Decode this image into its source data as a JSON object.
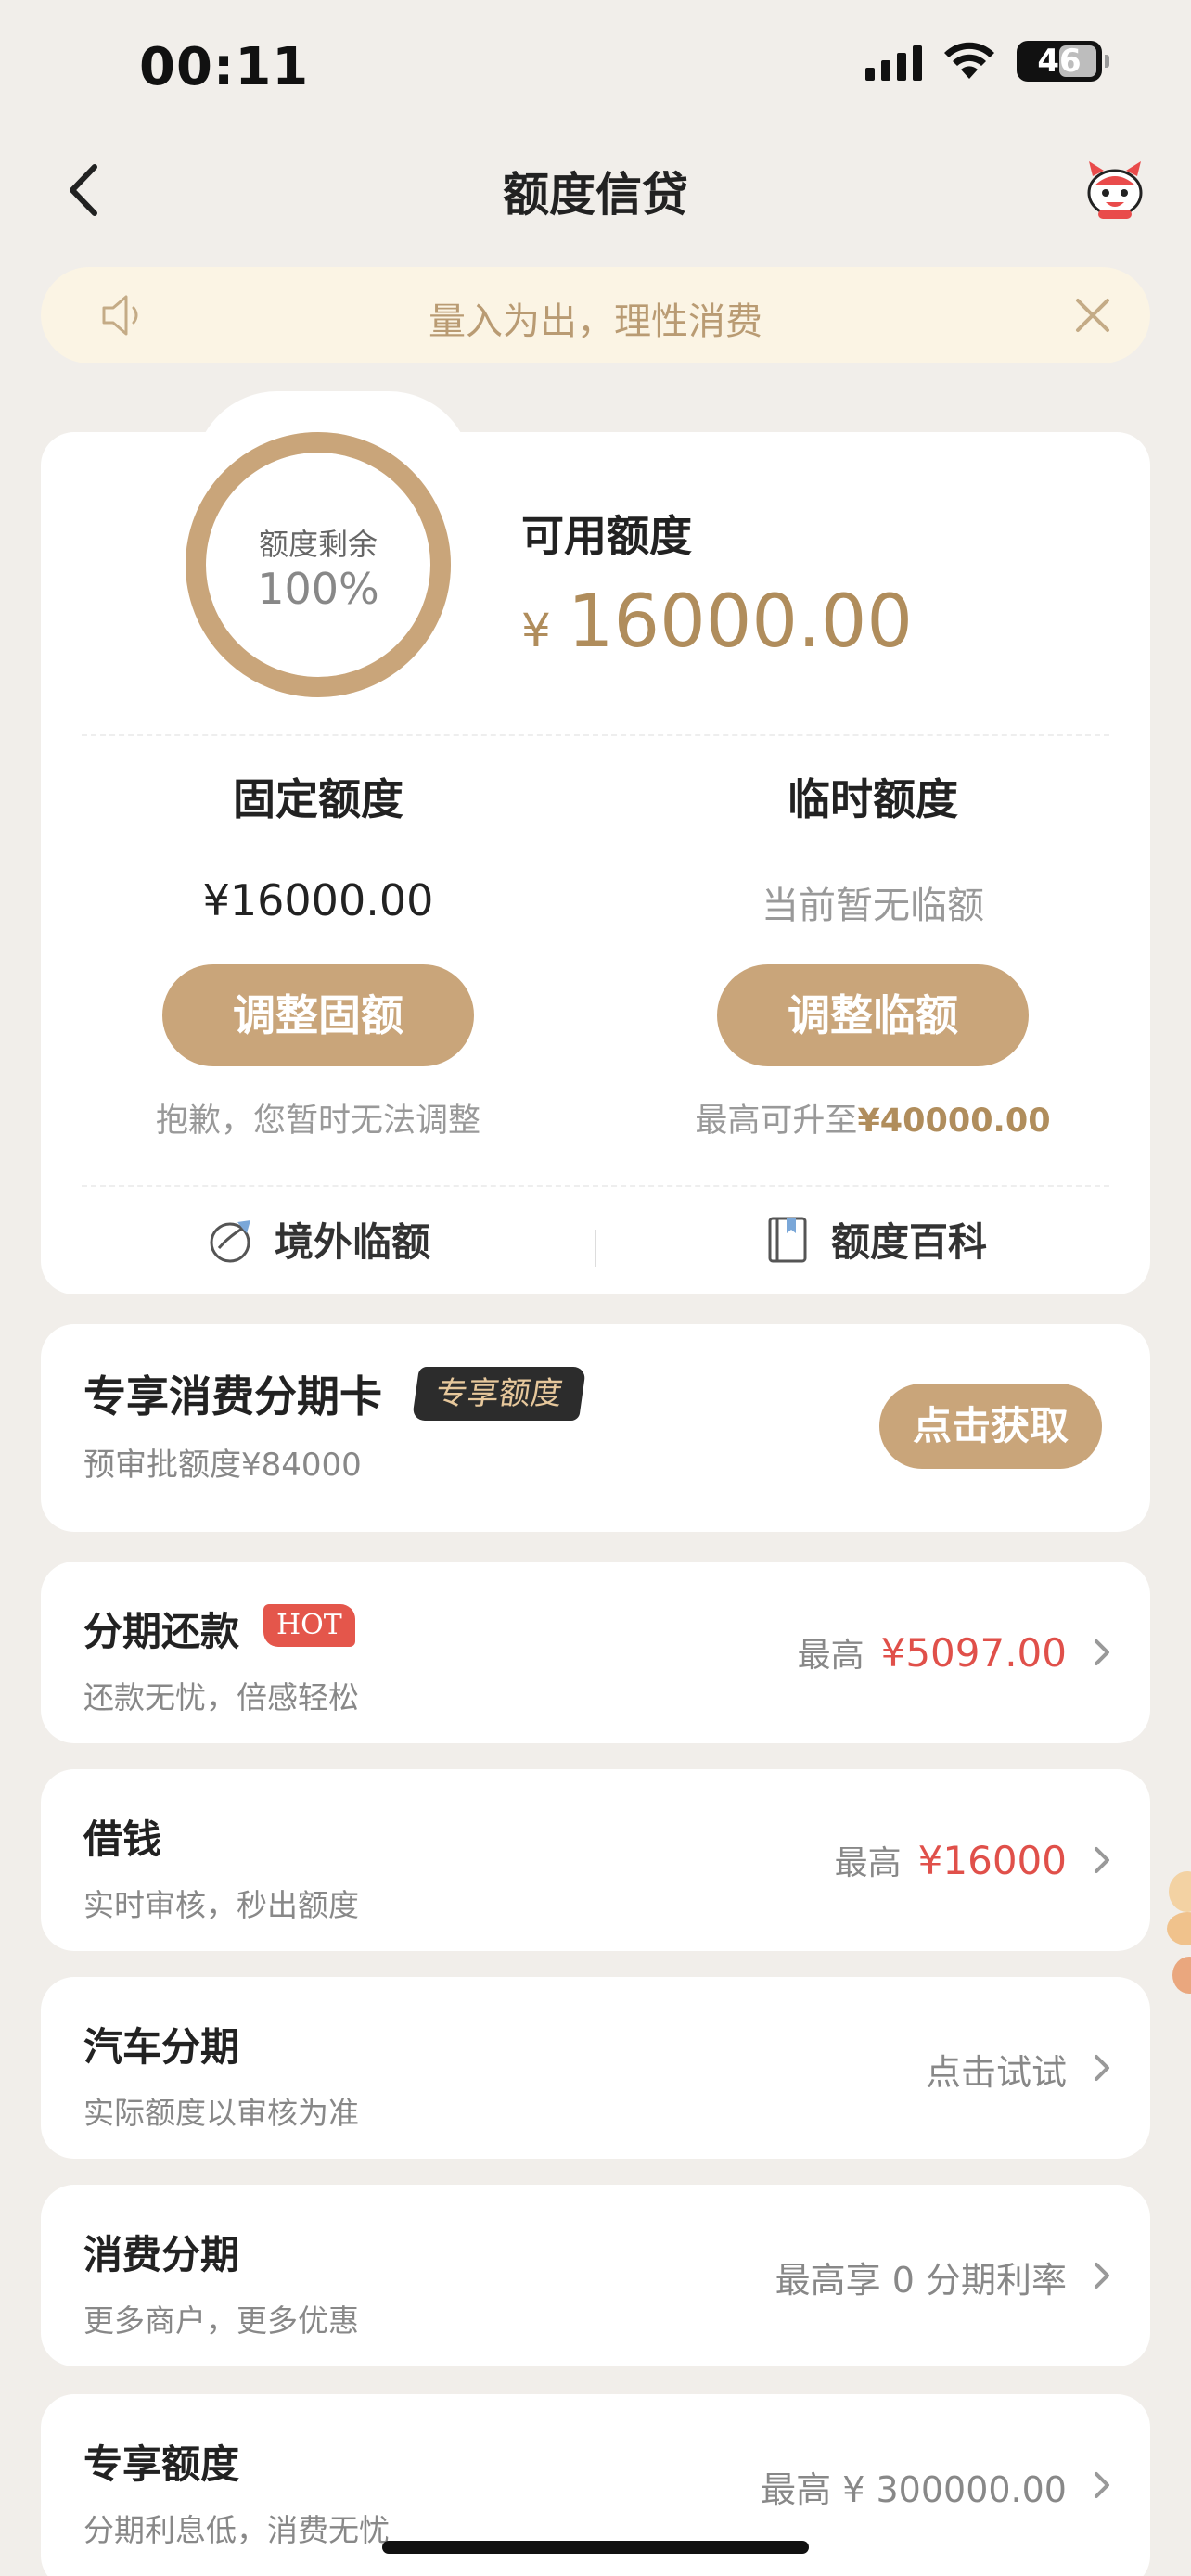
{
  "status": {
    "time": "00:11",
    "battery": "46"
  },
  "nav": {
    "title": "额度信贷"
  },
  "notice": {
    "text": "量入为出，理性消费"
  },
  "credit": {
    "ring_label": "额度剩余",
    "ring_percent": "100%",
    "ring_fraction": 1.0,
    "available_label": "可用额度",
    "available_currency": "¥",
    "available_amount": "16000.00",
    "fixed": {
      "label": "固定额度",
      "value": "¥16000.00",
      "button": "调整固额",
      "note": "抱歉，您暂时无法调整"
    },
    "temporary": {
      "label": "临时额度",
      "value": "当前暂无临额",
      "button": "调整临额",
      "note_prefix": "最高可升至",
      "note_amount": "¥40000.00"
    },
    "shortcuts": [
      {
        "label": "境外临额",
        "icon": "globe-plane-icon"
      },
      {
        "label": "额度百科",
        "icon": "book-icon"
      }
    ]
  },
  "exclusive_card": {
    "title": "专享消费分期卡",
    "badge": "专享额度",
    "subtitle": "预审批额度¥84000",
    "button": "点击获取"
  },
  "rows": [
    {
      "title": "分期还款",
      "badge": "HOT",
      "subtitle": "还款无忧，倍感轻松",
      "right_prefix": "最高",
      "right_value": "¥5097.00"
    },
    {
      "title": "借钱",
      "subtitle": "实时审核，秒出额度",
      "right_prefix": "最高",
      "right_value": "¥16000"
    },
    {
      "title": "汽车分期",
      "subtitle": "实际额度以审核为准",
      "right_prefix": "",
      "right_value": "点击试试"
    },
    {
      "title": "消费分期",
      "subtitle": "更多商户，更多优惠",
      "right_prefix": "",
      "right_value": "最高享 0 分期利率"
    },
    {
      "title": "专享额度",
      "subtitle": "分期利息低，消费无忧",
      "right_prefix": "",
      "right_value": "最高 ¥ 300000.00"
    }
  ],
  "colors": {
    "accent": "#c9a57a",
    "gold_text": "#b08d5c",
    "red": "#e0504a",
    "background": "#f1eeea"
  }
}
